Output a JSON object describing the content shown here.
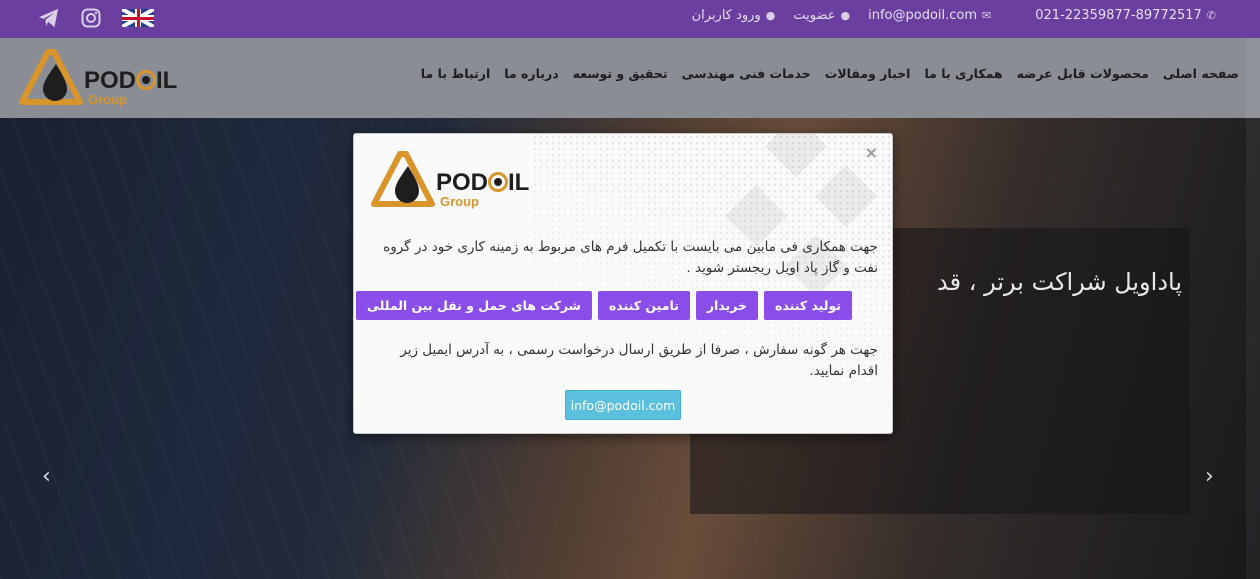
{
  "topbar": {
    "phone": "021-22359877-89772517",
    "email": "info@podoil.com",
    "signup": "عضویت",
    "login": "ورود کاربران",
    "icons": [
      "telegram-icon",
      "instagram-icon",
      "uk-flag-icon",
      "phone-icon",
      "envelope-icon",
      "user-icon"
    ]
  },
  "brand": {
    "name": "PODOIL",
    "sub": "Group",
    "colors": {
      "accent": "#d9942a",
      "purple": "#6b3fa0",
      "button": "#8a4dea",
      "email_button": "#5bc0de"
    }
  },
  "nav": {
    "items": [
      "صفحه اصلی",
      "محصولات قابل عرضه",
      "همکاری با ما",
      "اخبار ومقالات",
      "خدمات فنی مهندسی",
      "تحقیق و توسعه",
      "درباره ما",
      "ارتباط با ما"
    ]
  },
  "hero": {
    "caption": "پاداویل شراکت برتر ، قد",
    "prev": "‹",
    "next": "›"
  },
  "modal": {
    "close": "×",
    "intro": "جهت همکاری فی مابین می بایست با تکمیل فرم های مربوط به زمینه کاری خود در گروه نفت و گاز پاد اویل ریجستر شوید .",
    "buttons": [
      "تولید کننده",
      "خریدار",
      "تامین کننده",
      "شرکت های حمل و نقل بین المللی"
    ],
    "note": "جهت هر گونه سفارش ، صرفا از طریق ارسال درخواست رسمی ، به آدرس ایمیل زیر اقدام نمایید.",
    "email_button": "info@podoil.com"
  }
}
